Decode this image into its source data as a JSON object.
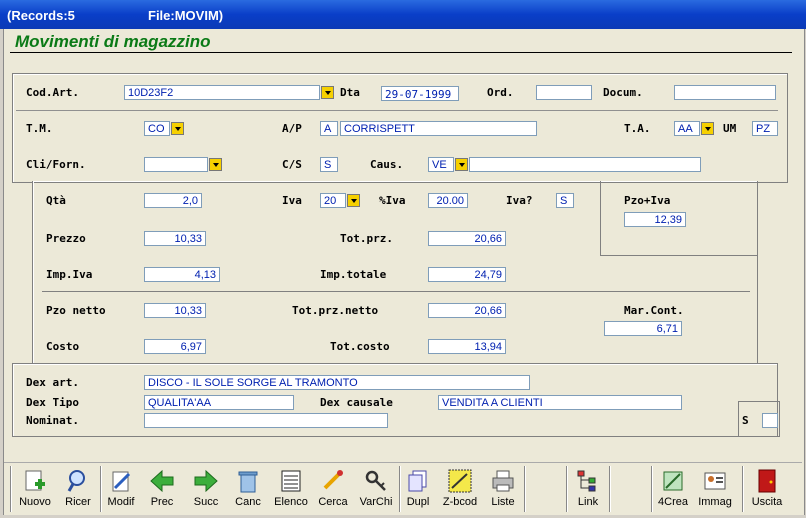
{
  "titlebar": {
    "records": "(Records:5",
    "file": "File:MOVIM)"
  },
  "heading": "Movimenti di magazzino",
  "labels": {
    "cod_art": "Cod.Art.",
    "dta": "Dta",
    "ord": "Ord.",
    "docum": "Docum.",
    "tm": "T.M.",
    "ap": "A/P",
    "ta": "T.A.",
    "um": "UM",
    "cli_forn": "Cli/Forn.",
    "cs": "C/S",
    "caus": "Caus.",
    "qta": "Qtà",
    "iva": "Iva",
    "perc_iva": "%Iva",
    "iva_q": "Iva?",
    "pzo_iva": "Pzo+Iva",
    "prezzo": "Prezzo",
    "tot_prz": "Tot.prz.",
    "imp_iva": "Imp.Iva",
    "imp_totale": "Imp.totale",
    "pzo_netto": "Pzo netto",
    "tot_prz_netto": "Tot.prz.netto",
    "mar_cont": "Mar.Cont.",
    "costo": "Costo",
    "tot_costo": "Tot.costo",
    "dex_art": "Dex art.",
    "dex_tipo": "Dex Tipo",
    "dex_causale": "Dex causale",
    "nominat": "Nominat.",
    "s": "S"
  },
  "values": {
    "cod_art": "10D23F2",
    "dta": "29-07-1999",
    "ord": "",
    "docum": "",
    "tm": "CO",
    "ap_code": "A",
    "ap_desc": "CORRISPETT",
    "ta": "AA",
    "um": "PZ",
    "cli_forn": "",
    "cs": "S",
    "caus": "VE",
    "caus_desc": "",
    "qta": "2,0",
    "iva": "20",
    "perc_iva": "20.00",
    "iva_q": "S",
    "pzo_iva": "12,39",
    "prezzo": "10,33",
    "tot_prz": "20,66",
    "imp_iva": "4,13",
    "imp_totale": "24,79",
    "pzo_netto": "10,33",
    "tot_prz_netto": "20,66",
    "mar_cont": "6,71",
    "costo": "6,97",
    "tot_costo": "13,94",
    "dex_art": "DISCO  - IL SOLE SORGE AL TRAMONTO",
    "dex_tipo": "QUALITA'AA",
    "dex_causale": "VENDITA A CLIENTI",
    "nominat": "",
    "s": ""
  },
  "toolbar": [
    {
      "label": "Nuovo",
      "icon": "new-record-icon"
    },
    {
      "label": "Ricer",
      "icon": "search-icon"
    },
    {
      "label": "Modif",
      "icon": "edit-icon"
    },
    {
      "label": "Prec",
      "icon": "arrow-left-icon"
    },
    {
      "label": "Succ",
      "icon": "arrow-right-icon"
    },
    {
      "label": "Canc",
      "icon": "trash-icon"
    },
    {
      "label": "Elenco",
      "icon": "list-icon"
    },
    {
      "label": "Cerca",
      "icon": "find-icon"
    },
    {
      "label": "VarChi",
      "icon": "keys-icon"
    },
    {
      "label": "Dupl",
      "icon": "duplicate-icon"
    },
    {
      "label": "Z-bcod",
      "icon": "barcode-icon"
    },
    {
      "label": "Liste",
      "icon": "printer-icon"
    },
    {
      "label": "Link",
      "icon": "tree-icon"
    },
    {
      "label": "4Crea",
      "icon": "create-icon"
    },
    {
      "label": "Immag",
      "icon": "image-icon"
    },
    {
      "label": "Uscita",
      "icon": "exit-door-icon"
    }
  ],
  "colors": {
    "heading": "#0a7a16",
    "field_text": "#0020b0",
    "dropdown": "#f6d000",
    "titlebar": "#0a3ec8"
  }
}
